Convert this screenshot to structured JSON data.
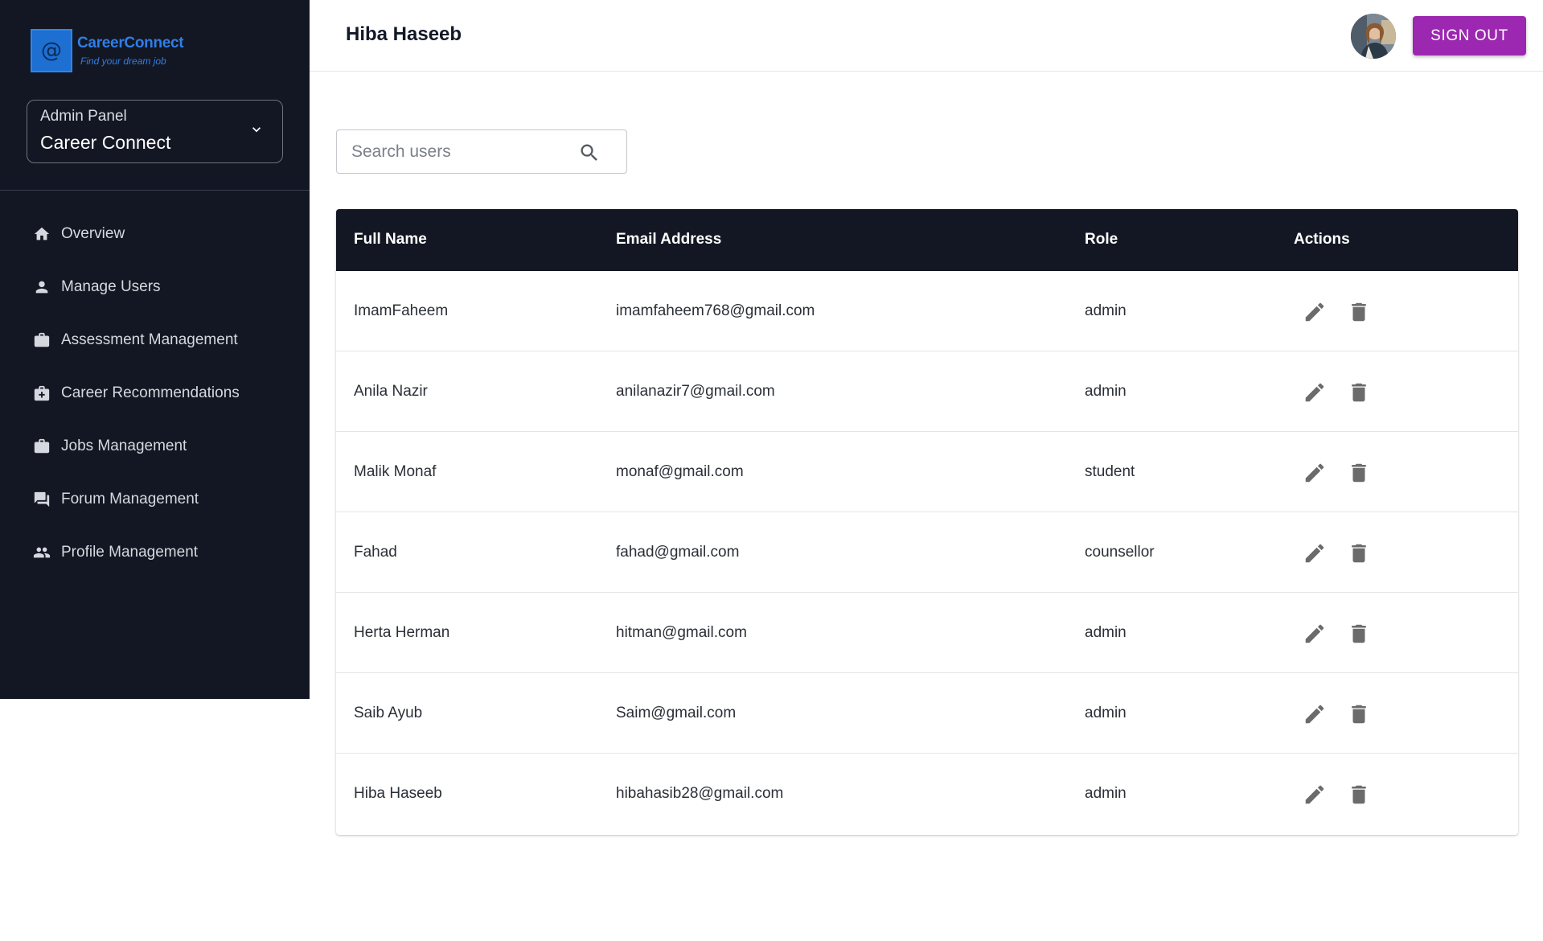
{
  "brand": {
    "logo_glyph": "@",
    "name": "CareerConnect",
    "tagline": "Find your dream job"
  },
  "panel_select": {
    "label": "Admin Panel",
    "value": "Career Connect"
  },
  "nav": [
    {
      "label": "Overview",
      "icon": "home-icon"
    },
    {
      "label": "Manage Users",
      "icon": "person-icon"
    },
    {
      "label": "Assessment Management",
      "icon": "briefcase-icon"
    },
    {
      "label": "Career Recommendations",
      "icon": "medical-bag-icon"
    },
    {
      "label": "Jobs Management",
      "icon": "briefcase-icon"
    },
    {
      "label": "Forum Management",
      "icon": "forum-icon"
    },
    {
      "label": "Profile Management",
      "icon": "people-icon"
    }
  ],
  "header": {
    "user_name": "Hiba Haseeb",
    "signout_label": "SIGN OUT"
  },
  "search": {
    "placeholder": "Search users",
    "value": ""
  },
  "table": {
    "columns": [
      "Full Name",
      "Email Address",
      "Role",
      "Actions"
    ],
    "rows": [
      {
        "name": "ImamFaheem",
        "email": "imamfaheem768@gmail.com",
        "role": "admin"
      },
      {
        "name": "Anila Nazir",
        "email": "anilanazir7@gmail.com",
        "role": "admin"
      },
      {
        "name": "Malik Monaf",
        "email": "monaf@gmail.com",
        "role": "student"
      },
      {
        "name": "Fahad",
        "email": "fahad@gmail.com",
        "role": "counsellor"
      },
      {
        "name": "Herta Herman",
        "email": "hitman@gmail.com",
        "role": "admin"
      },
      {
        "name": "Saib Ayub",
        "email": "Saim@gmail.com",
        "role": "admin"
      },
      {
        "name": "Hiba Haseeb",
        "email": "hibahasib28@gmail.com",
        "role": "admin"
      }
    ]
  },
  "colors": {
    "sidebar_bg": "#121723",
    "accent": "#9c27b0",
    "brand_blue": "#2f7ee6",
    "icon_gray": "#6b6b6b"
  }
}
